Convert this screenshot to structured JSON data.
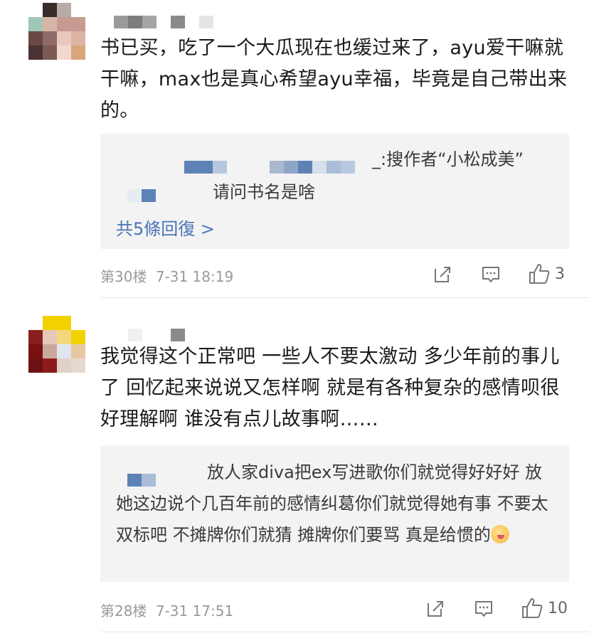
{
  "comments": [
    {
      "body": "书已买，吃了一个大瓜现在也缓过来了，ayu爱干嘛就干嘛，max也是真心希望ayu幸福，毕竟是自己带出来的。",
      "reply_preview": {
        "line1": "_:搜作者“小松成美”",
        "line2": "请问书名是啥",
        "more_label": "共5條回復 >"
      },
      "floor": "第30楼",
      "time": "7-31 18:19",
      "like_count": "3"
    },
    {
      "body": "我觉得这个正常吧 一些人不要太激动 多少年前的事儿了 回忆起来说说又怎样啊 就是有各种复杂的感情呗很好理解啊 谁没有点儿故事啊……",
      "reply_preview": {
        "line1": "放人家diva把ex写进歌你们就觉得好好好 放她这边说个几百年前的感情纠葛你们就觉得她有事 不要太双标吧 不摊牌你们就猜 摊牌你们要骂 真是给惯的"
      },
      "floor": "第28楼",
      "time": "7-31 17:51",
      "like_count": "10"
    }
  ],
  "icons": [
    "share-icon",
    "comment-icon",
    "thumbs-up-icon",
    "emoji-icon"
  ],
  "colors": {
    "link": "#4a74b8",
    "meta": "#9a9a9a",
    "reply_bg": "#f3f3f3"
  }
}
